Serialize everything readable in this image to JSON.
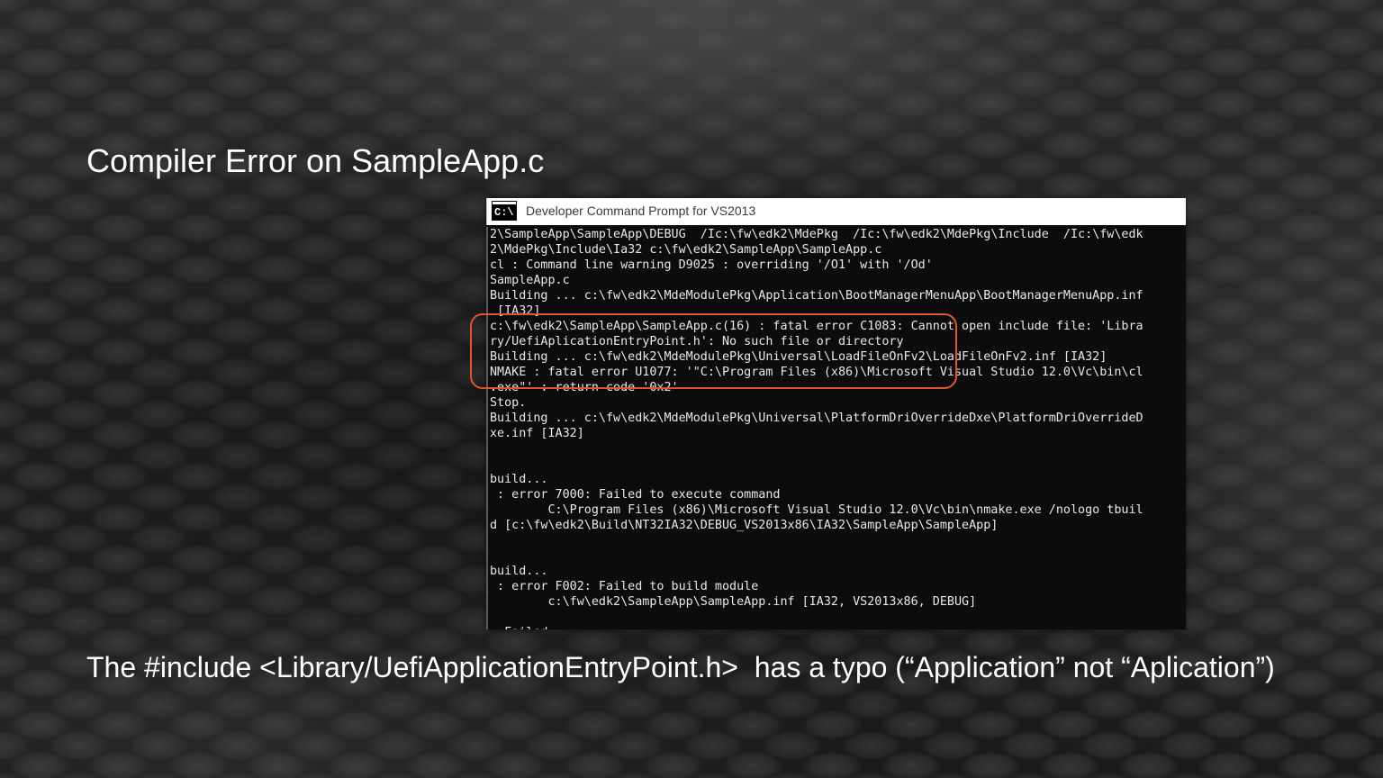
{
  "slide": {
    "title": "Compiler Error on SampleApp.c",
    "footer": "The #include <Library/UefiApplicationEntryPoint.h>  has a typo (“Application” not “Aplication”)"
  },
  "window": {
    "icon_text": "C:\\",
    "title": "Developer Command Prompt for VS2013",
    "highlight_color": "#e0562c"
  },
  "console": {
    "lines": [
      "2\\SampleApp\\SampleApp\\DEBUG  /Ic:\\fw\\edk2\\MdePkg  /Ic:\\fw\\edk2\\MdePkg\\Include  /Ic:\\fw\\edk",
      "2\\MdePkg\\Include\\Ia32 c:\\fw\\edk2\\SampleApp\\SampleApp.c",
      "cl : Command line warning D9025 : overriding '/O1' with '/Od'",
      "SampleApp.c",
      "Building ... c:\\fw\\edk2\\MdeModulePkg\\Application\\BootManagerMenuApp\\BootManagerMenuApp.inf",
      " [IA32]",
      "c:\\fw\\edk2\\SampleApp\\SampleApp.c(16) : fatal error C1083: Cannot open include file: 'Libra",
      "ry/UefiAplicationEntryPoint.h': No such file or directory",
      "Building ... c:\\fw\\edk2\\MdeModulePkg\\Universal\\LoadFileOnFv2\\LoadFileOnFv2.inf [IA32]",
      "NMAKE : fatal error U1077: '\"C:\\Program Files (x86)\\Microsoft Visual Studio 12.0\\Vc\\bin\\cl",
      ".exe\"' : return code '0x2'",
      "Stop.",
      "Building ... c:\\fw\\edk2\\MdeModulePkg\\Universal\\PlatformDriOverrideDxe\\PlatformDriOverrideD",
      "xe.inf [IA32]",
      "",
      "",
      "build...",
      " : error 7000: Failed to execute command",
      "        C:\\Program Files (x86)\\Microsoft Visual Studio 12.0\\Vc\\bin\\nmake.exe /nologo tbuil",
      "d [c:\\fw\\edk2\\Build\\NT32IA32\\DEBUG_VS2013x86\\IA32\\SampleApp\\SampleApp]",
      "",
      "",
      "build...",
      " : error F002: Failed to build module",
      "        c:\\fw\\edk2\\SampleApp\\SampleApp.inf [IA32, VS2013x86, DEBUG]",
      "",
      "- Failed -"
    ]
  }
}
